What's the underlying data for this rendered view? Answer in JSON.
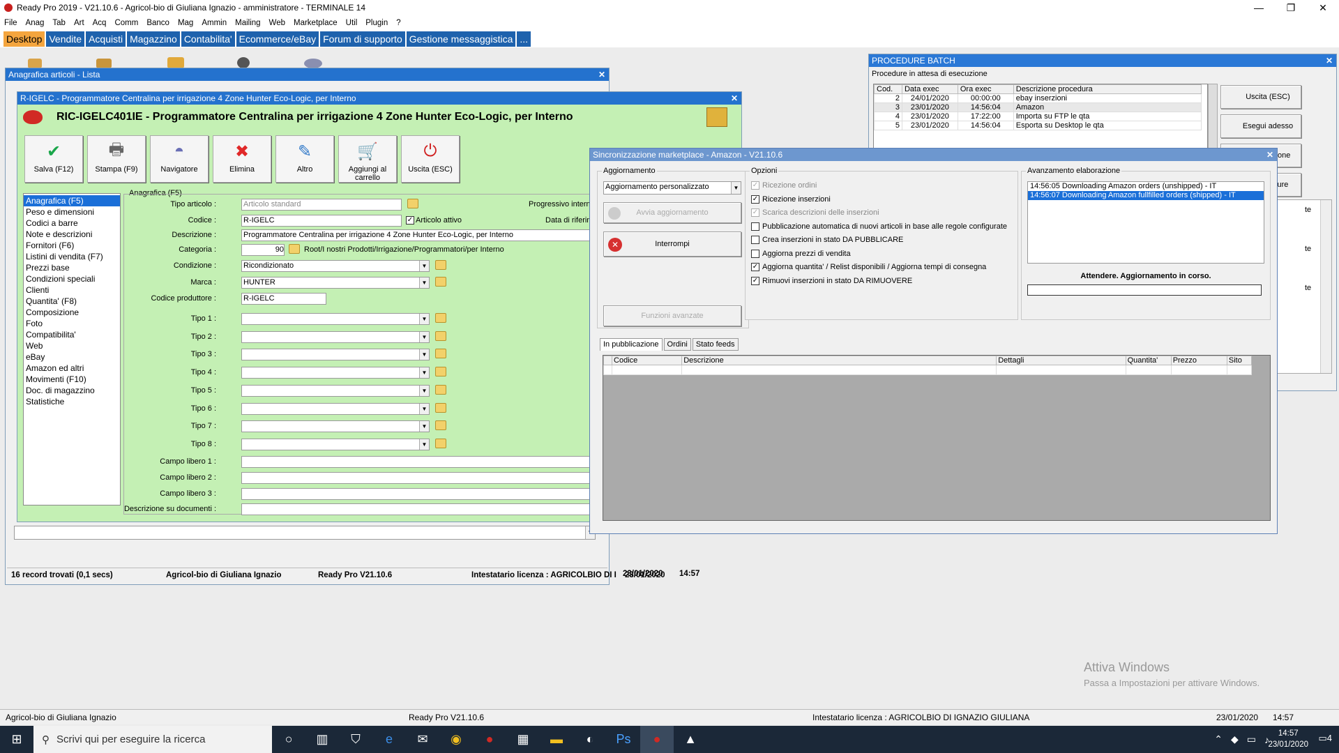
{
  "app": {
    "title": "Ready Pro 2019 - V21.10.6 - Agricol-bio di Giuliana Ignazio - amministratore - TERMINALE 14",
    "menu": [
      "File",
      "Anag",
      "Tab",
      "Art",
      "Acq",
      "Comm",
      "Banco",
      "Mag",
      "Ammin",
      "Mailing",
      "Web",
      "Marketplace",
      "Util",
      "Plugin",
      "?"
    ],
    "tabs": [
      "Desktop",
      "Vendite",
      "Acquisti",
      "Magazzino",
      "Contabilita'",
      "Ecommerce/eBay",
      "Forum di supporto",
      "Gestione messaggistica",
      "..."
    ]
  },
  "lista": {
    "title": "Anagrafica articoli - Lista",
    "status": [
      "16 record trovati (0,1 secs)",
      "Agricol-bio di Giuliana Ignazio",
      "Ready Pro V21.10.6",
      "Intestatario licenza : AGRICOLBIO DI I",
      "23/01/2020",
      "14:57"
    ]
  },
  "articolo": {
    "title": "R-IGELC - Programmatore Centralina per irrigazione 4 Zone Hunter Eco-Logic, per Interno",
    "heading": "RIC-IGELC401IE - Programmatore Centralina per irrigazione 4 Zone Hunter Eco-Logic, per Interno",
    "tools": [
      "Salva (F12)",
      "Stampa (F9)",
      "Navigatore",
      "Elimina",
      "Altro",
      "Aggiungi al carrello",
      "Uscita (ESC)"
    ],
    "nav": [
      "Anagrafica (F5)",
      "Peso e dimensioni",
      "Codici a barre",
      "Note e descrizioni",
      "Fornitori (F6)",
      "Listini di vendita (F7)",
      "Prezzi base",
      "Condizioni speciali",
      "Clienti",
      "Quantita' (F8)",
      "Composizione",
      "Foto",
      "Compatibilita'",
      "Web",
      "eBay",
      "Amazon ed altri",
      "Movimenti (F10)",
      "Doc. di magazzino",
      "Statistiche"
    ],
    "section": "Anagrafica (F5)",
    "labels": {
      "tipo": "Tipo articolo :",
      "codice": "Codice :",
      "descr": "Descrizione :",
      "cat": "Categoria :",
      "cond": "Condizione :",
      "marca": "Marca :",
      "codprod": "Codice produttore :",
      "tipi": [
        "Tipo 1 :",
        "Tipo 2 :",
        "Tipo 3 :",
        "Tipo 4 :",
        "Tipo 5 :",
        "Tipo 6 :",
        "Tipo 7 :",
        "Tipo 8 :"
      ],
      "campi": [
        "Campo libero 1 :",
        "Campo libero 2 :",
        "Campo libero 3 :"
      ],
      "descdoc": "Descrizione su documenti :",
      "prog": "Progressivo interno (ID)",
      "dataref": "Data di riferimento"
    },
    "values": {
      "tipo": "Articolo standard",
      "codice": "R-IGELC",
      "attivo": "Articolo attivo",
      "descr": "Programmatore Centralina per irrigazione 4 Zone Hunter Eco-Logic, per Interno",
      "catnum": "90",
      "catpath": "Root/I nostri Prodotti/Irrigazione/Programmatori/per Interno",
      "cond": "Ricondizionato",
      "marca": "HUNTER",
      "codprod": "R-IGELC"
    }
  },
  "batch": {
    "title": "PROCEDURE BATCH",
    "sub": "Procedure in attesa di esecuzione",
    "cols": [
      "Cod.",
      "Data exec",
      "Ora exec",
      "Descrizione procedura"
    ],
    "rows": [
      [
        "2",
        "24/01/2020",
        "00:00:00",
        "ebay inserzioni"
      ],
      [
        "3",
        "23/01/2020",
        "14:56:04",
        "Amazon"
      ],
      [
        "4",
        "23/01/2020",
        "17:22:00",
        "Importa su FTP le qta"
      ],
      [
        "5",
        "23/01/2020",
        "14:56:04",
        "Esporta su Desktop le qta"
      ]
    ],
    "buttons": [
      "Uscita (ESC)",
      "Esegui adesso",
      "a esecuzione",
      "a procedure"
    ],
    "side": [
      "te",
      "te",
      "te"
    ]
  },
  "sync": {
    "title": "Sincronizzazione marketplace - Amazon - V21.10.6",
    "agg": "Aggiornamento",
    "mode": "Aggiornamento personalizzato",
    "avvia": "Avvia aggiornamento",
    "interrompi": "Interrompi",
    "avanzate": "Funzioni avanzate",
    "opz": "Opzioni",
    "options": [
      {
        "label": "Ricezione ordini",
        "checked": true,
        "disabled": true
      },
      {
        "label": "Ricezione inserzioni",
        "checked": true,
        "disabled": false
      },
      {
        "label": "Scarica descrizioni delle inserzioni",
        "checked": true,
        "disabled": true
      },
      {
        "label": "Pubblicazione automatica di nuovi articoli in base alle regole configurate",
        "checked": false,
        "disabled": false
      },
      {
        "label": "Crea inserzioni in stato DA PUBBLICARE",
        "checked": false,
        "disabled": false
      },
      {
        "label": "Aggiorna prezzi di vendita",
        "checked": false,
        "disabled": false
      },
      {
        "label": "Aggiorna quantita' / Relist disponibili / Aggiorna tempi di consegna",
        "checked": true,
        "disabled": false
      },
      {
        "label": "Rimuovi inserzioni in stato DA RIMUOVERE",
        "checked": true,
        "disabled": false
      }
    ],
    "avanz": "Avanzamento elaborazione",
    "log": [
      "14:56:05 Downloading Amazon orders (unshipped) - IT",
      "14:56:07 Downloading Amazon fullfilled orders (shipped) - IT"
    ],
    "wait": "Attendere. Aggiornamento in corso.",
    "tabs": [
      "In pubblicazione",
      "Ordini",
      "Stato feeds"
    ],
    "cols": [
      "Codice",
      "Descrizione",
      "Dettagli",
      "Quantita'",
      "Prezzo",
      "Sito"
    ]
  },
  "watermark": {
    "t1": "Attiva Windows",
    "t2": "Passa a Impostazioni per attivare Windows."
  },
  "status": {
    "s1": "Agricol-bio di Giuliana Ignazio",
    "s2": "Ready Pro V21.10.6",
    "s3": "Intestatario licenza : AGRICOLBIO DI IGNAZIO GIULIANA",
    "s4": "23/01/2020",
    "s5": "14:57"
  },
  "taskbar": {
    "search": "Scrivi qui per eseguire la ricerca",
    "time": "14:57",
    "date": "23/01/2020",
    "notif": "4"
  }
}
